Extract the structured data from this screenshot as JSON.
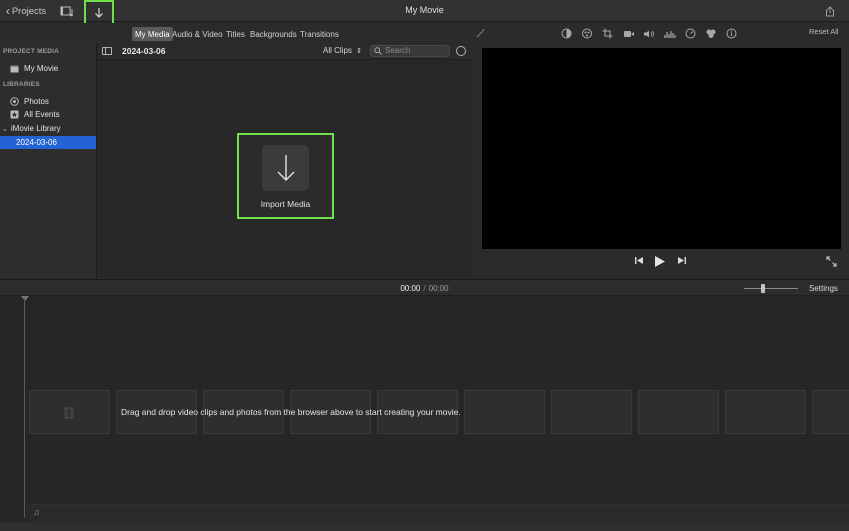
{
  "titlebar": {
    "back_label": "Projects",
    "title": "My Movie"
  },
  "tabs": [
    {
      "label": "My Media",
      "active": true
    },
    {
      "label": "Audio & Video",
      "active": false
    },
    {
      "label": "Titles",
      "active": false
    },
    {
      "label": "Backgrounds",
      "active": false
    },
    {
      "label": "Transitions",
      "active": false
    }
  ],
  "adjust_tools": [
    "magic-wand-icon",
    "color-balance-icon",
    "color-correction-icon",
    "crop-icon",
    "stabilization-icon",
    "volume-icon",
    "equalizer-icon",
    "speed-icon",
    "noise-reduction-icon",
    "info-icon"
  ],
  "reset_all_label": "Reset All",
  "sidebar": {
    "project_media_heading": "PROJECT MEDIA",
    "project_items": [
      {
        "label": "My Movie",
        "icon": "movie-icon"
      }
    ],
    "libraries_heading": "LIBRARIES",
    "library_items": [
      {
        "label": "Photos",
        "icon": "photos-icon"
      },
      {
        "label": "All Events",
        "icon": "star-icon"
      }
    ],
    "library_name": "iMovie Library",
    "event": "2024-03-06"
  },
  "browser": {
    "event_title": "2024-03-06",
    "filter_label": "All Clips",
    "search_placeholder": "Search",
    "import_label": "Import Media"
  },
  "timeline": {
    "current_time": "00:00",
    "separator": "/",
    "total_time": "00:00",
    "settings_label": "Settings",
    "drop_message": "Drag and drop video clips and photos from the browser above to start creating your movie."
  },
  "colors": {
    "accent": "#2463d4",
    "highlight_border": "#6fe14a"
  }
}
